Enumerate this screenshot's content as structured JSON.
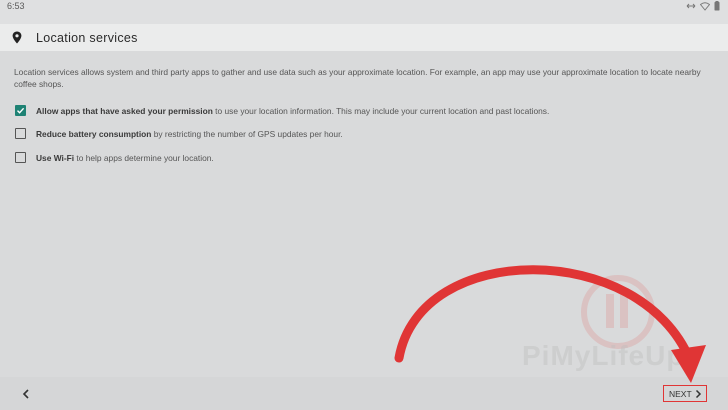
{
  "status_bar": {
    "time": "6:53",
    "icons": [
      "data-transfer-icon",
      "wifi-icon",
      "battery-icon"
    ]
  },
  "header": {
    "icon": "location-pin-icon",
    "title": "Location services"
  },
  "intro": "Location services allows system and third party apps to gather and use data such as your approximate location. For example, an app may use your approximate location to locate nearby coffee shops.",
  "options": [
    {
      "bold": "Allow apps that have asked your permission",
      "rest": " to use your location information. This may include your current location and past locations.",
      "checked": true
    },
    {
      "bold": "Reduce battery consumption",
      "rest": " by restricting the number of GPS updates per hour.",
      "checked": false
    },
    {
      "bold": "Use Wi-Fi",
      "rest": " to help apps determine your location.",
      "checked": false
    }
  ],
  "bottom_bar": {
    "back_icon": "chevron-left-icon",
    "next_label": "NEXT",
    "next_icon": "chevron-right-icon"
  },
  "watermark": {
    "text": "PiMyLifeUp"
  },
  "colors": {
    "accent": "#1e8274",
    "annotation": "#e03535"
  }
}
